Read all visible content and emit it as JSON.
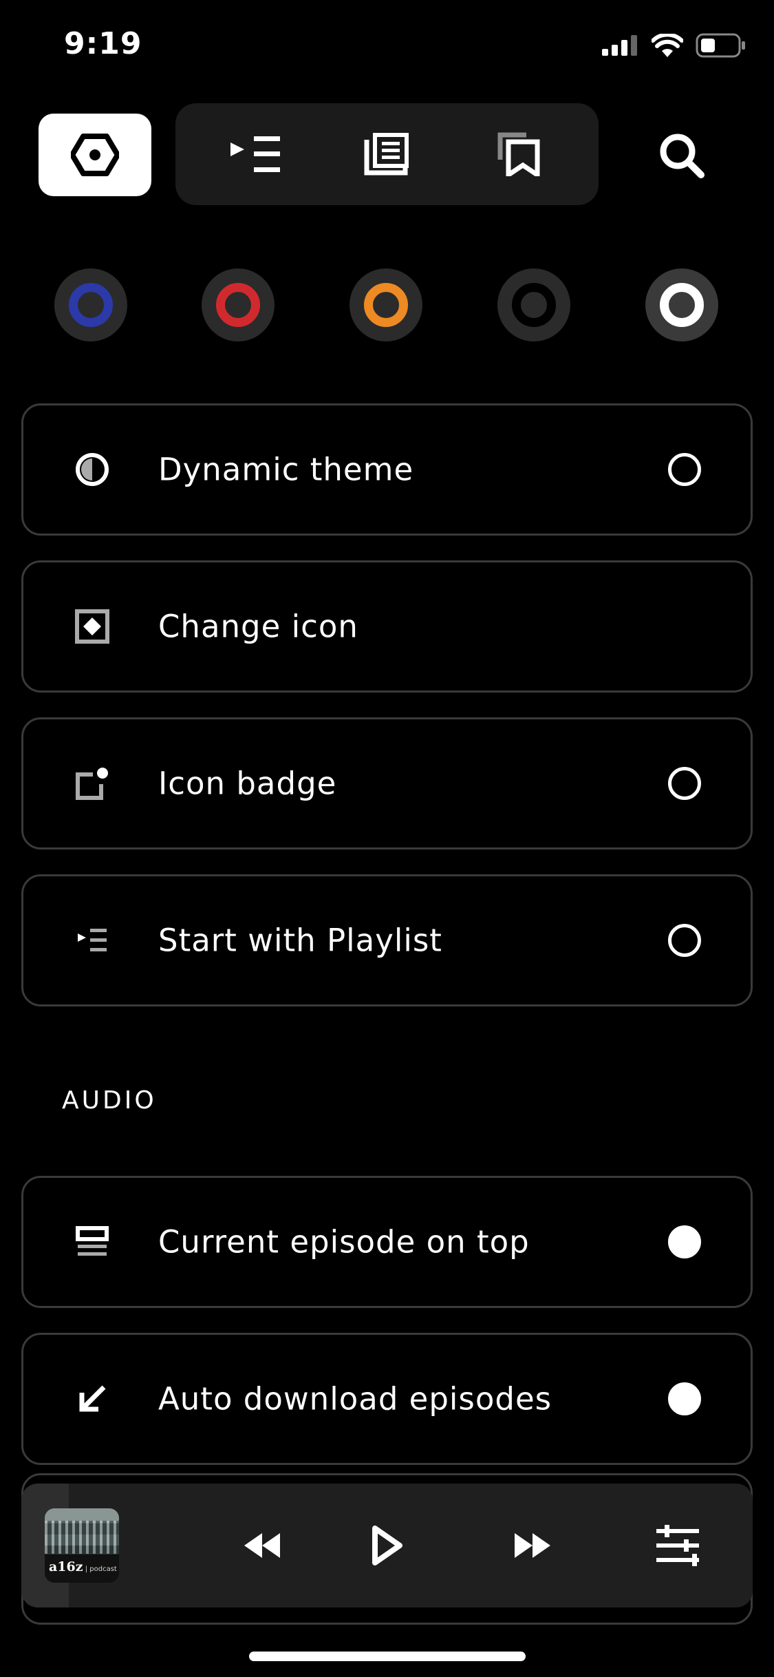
{
  "status_bar": {
    "time": "9:19"
  },
  "theme_swatches": [
    {
      "name": "blue",
      "ring_color": "#2b3aa8"
    },
    {
      "name": "red",
      "ring_color": "#d12a2e"
    },
    {
      "name": "orange",
      "ring_color": "#ee8a23"
    },
    {
      "name": "black",
      "ring_color": "#000000"
    },
    {
      "name": "white",
      "ring_color": "#ffffff"
    }
  ],
  "settings": {
    "dynamic_theme": {
      "label": "Dynamic theme",
      "on": false
    },
    "change_icon": {
      "label": "Change icon"
    },
    "icon_badge": {
      "label": "Icon badge",
      "on": false
    },
    "start_with_playlist": {
      "label": "Start with Playlist",
      "on": false
    }
  },
  "audio_section": {
    "heading": "AUDIO",
    "current_episode_on_top": {
      "label": "Current episode on top",
      "on": true
    },
    "auto_download_episodes": {
      "label": "Auto download episodes",
      "on": true
    }
  },
  "player": {
    "artwork_brand": "a16z",
    "artwork_sub": "podcast",
    "progress": 0.065
  }
}
